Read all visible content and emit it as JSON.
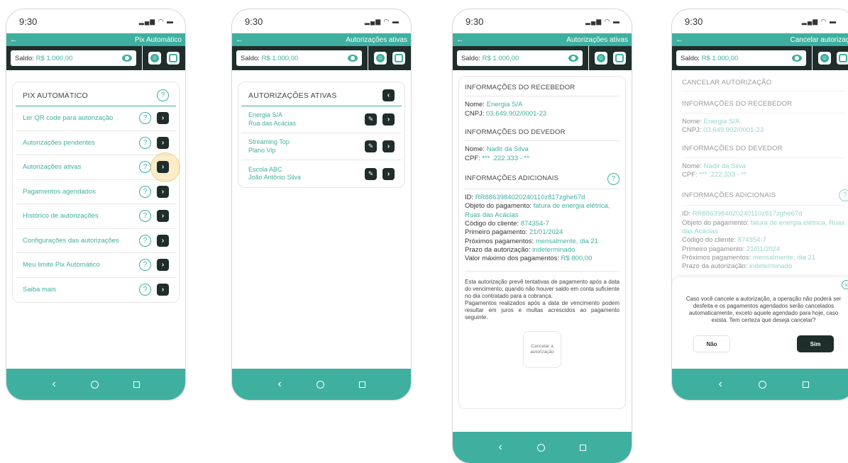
{
  "status_time": "9:30",
  "status_icons": "₂₂₂ ◠ ▬",
  "balance": {
    "label": "Saldo:",
    "value": "R$ 1.000,00"
  },
  "screen1": {
    "topbar_title": "Pix Automático",
    "card_title": "PIX AUTOMÁTICO",
    "items": [
      {
        "label": "Ler QR code para autorização"
      },
      {
        "label": "Autorizações pendentes"
      },
      {
        "label": "Autorizações ativas"
      },
      {
        "label": "Pagamentos agendados"
      },
      {
        "label": "Histórico de autorizações"
      },
      {
        "label": "Configurações das autorizações"
      },
      {
        "label": "Meu limite Pix Automático"
      },
      {
        "label": "Saiba mais"
      }
    ]
  },
  "screen2": {
    "topbar_title": "Autorizações ativas",
    "card_title": "AUTORIZAÇÕES ATIVAS",
    "items": [
      {
        "line1": "Energia S/A",
        "line2": "Rua das Acácias"
      },
      {
        "line1": "Streaming Top",
        "line2": "Plano Vip"
      },
      {
        "line1": "Escola ABC",
        "line2": "João Antônio Silva"
      }
    ]
  },
  "screen3": {
    "topbar_title": "Autorizações ativas",
    "receiver_title": "INFORMAÇÕES DO RECEBEDOR",
    "receiver_name_label": "Nome:",
    "receiver_name": "Energia S/A",
    "receiver_cnpj_label": "CNPJ:",
    "receiver_cnpj": "03.649.902/0001-23",
    "debtor_title": "INFORMAÇÕES DO DEVEDOR",
    "debtor_name_label": "Nome:",
    "debtor_name": "Nadir da Silva",
    "debtor_cpf_label": "CPF:",
    "debtor_cpf": "*** .222.333 - **",
    "extra_title": "INFORMAÇÕES ADICIONAIS",
    "id_label": "ID:",
    "id_value": "RR8863984020240110z817zghe67d",
    "object_label": "Objeto do pagamento:",
    "object_value": "fatura de energia elétrica, Ruas das Acácias",
    "client_label": "Código do cliente:",
    "client_value": "874354-7",
    "first_label": "Primeiro pagamento:",
    "first_value": "21/01/2024",
    "next_label": "Próximos pagamentos:",
    "next_value": "mensalmente, dia 21",
    "term_label": "Prazo da autorização:",
    "term_value": "indeterminado",
    "max_label": "Valor máximo dos pagamentos:",
    "max_value": "R$ 800,00",
    "notice_1": "Esta autorização prevê tentativas de pagamento após a data do vencimento, quando não houver saldo em conta suficiente no dia contratado para a cobrança.",
    "notice_2": "Pagamentos realizados após a data de vencimento podem resultar em juros e multas acrescidos ao pagamento seguinte.",
    "cancel_button": "Cancelar a autorização"
  },
  "screen4": {
    "topbar_title": "Cancelar autorização",
    "cancel_title": "CANCELAR AUTORIZAÇÃO",
    "receiver_title": "INFORMAÇÕES DO RECEBEDOR",
    "receiver_name_label": "Nome:",
    "receiver_name": "Energia S/A",
    "receiver_cnpj_label": "CNPJ:",
    "receiver_cnpj": "03.649.902/0001-23",
    "debtor_title": "INFORMAÇÕES DO DEVEDOR",
    "debtor_name_label": "Nome:",
    "debtor_name": "Nadir da Silva",
    "debtor_cpf_label": "CPF:",
    "debtor_cpf": "*** .222.333 - **",
    "extra_title": "INFORMAÇÕES ADICIONAIS",
    "id_label": "ID:",
    "id_value": "RR8863984020240110z817zghe67d",
    "object_label": "Objeto do pagamento:",
    "object_value": "fatura de energia elétrica, Ruas das Acácias",
    "client_label": "Código do cliente:",
    "client_value": "874354-7",
    "first_label": "Primeiro pagamento:",
    "first_value": "21/01/2024",
    "next_label": "Próximos pagamentos:",
    "next_value": "mensalmente, dia 21",
    "term_label": "Prazo da autorização:",
    "term_value": "indeterminado",
    "dialog_text": "Caso você cancele a autorização, a operação não poderá ser desfeita e os pagamentos agendados serão cancelados automaticamente, exceto aquele agendado para hoje, caso exista. Tem certeza que deseja cancelar?",
    "btn_no": "Não",
    "btn_yes": "Sim"
  },
  "icons": {
    "back": "←",
    "help": "?",
    "go": "›",
    "edit": "✎",
    "close": "×",
    "nav_back": "‹"
  },
  "colors": {
    "accent": "#3fb0a0",
    "dark": "#1f2d2b"
  }
}
